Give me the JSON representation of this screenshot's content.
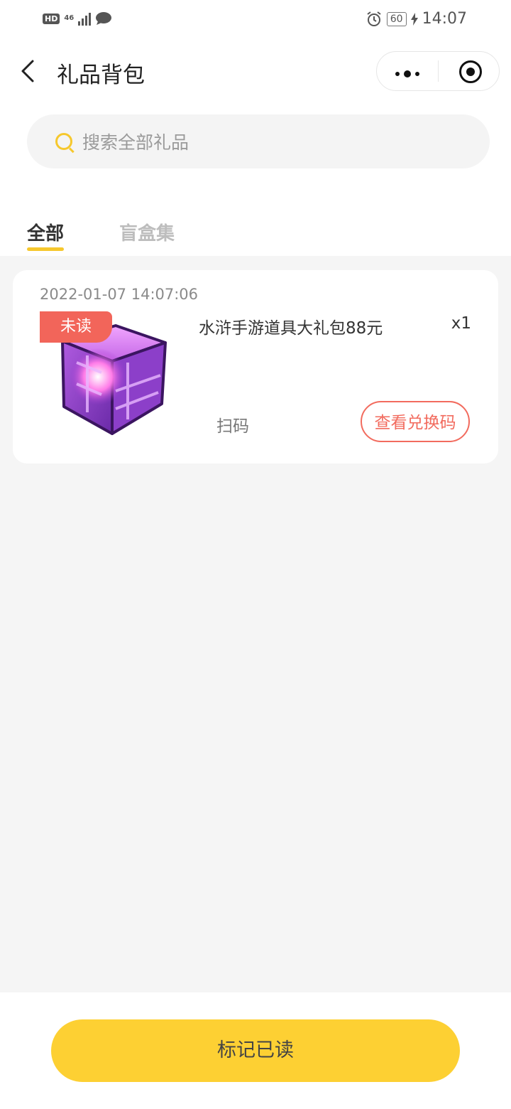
{
  "status_bar": {
    "hd": "HD",
    "network": "46",
    "battery": "60",
    "time": "14:07"
  },
  "nav": {
    "title": "礼品背包"
  },
  "search": {
    "placeholder": "搜索全部礼品"
  },
  "tabs": [
    {
      "label": "全部",
      "active": true
    },
    {
      "label": "盲盒集",
      "active": false
    }
  ],
  "gift_card": {
    "date": "2022-01-07 14:07:06",
    "badge": "未读",
    "name": "水浒手游道具大礼包88元",
    "quantity": "x1",
    "scan_label": "扫码",
    "redeem_label": "查看兑换码"
  },
  "footer": {
    "mark_read_label": "标记已读"
  },
  "colors": {
    "accent_yellow": "#fdd033",
    "badge_red": "#f2655a",
    "redeem_red": "#f26b5e"
  }
}
